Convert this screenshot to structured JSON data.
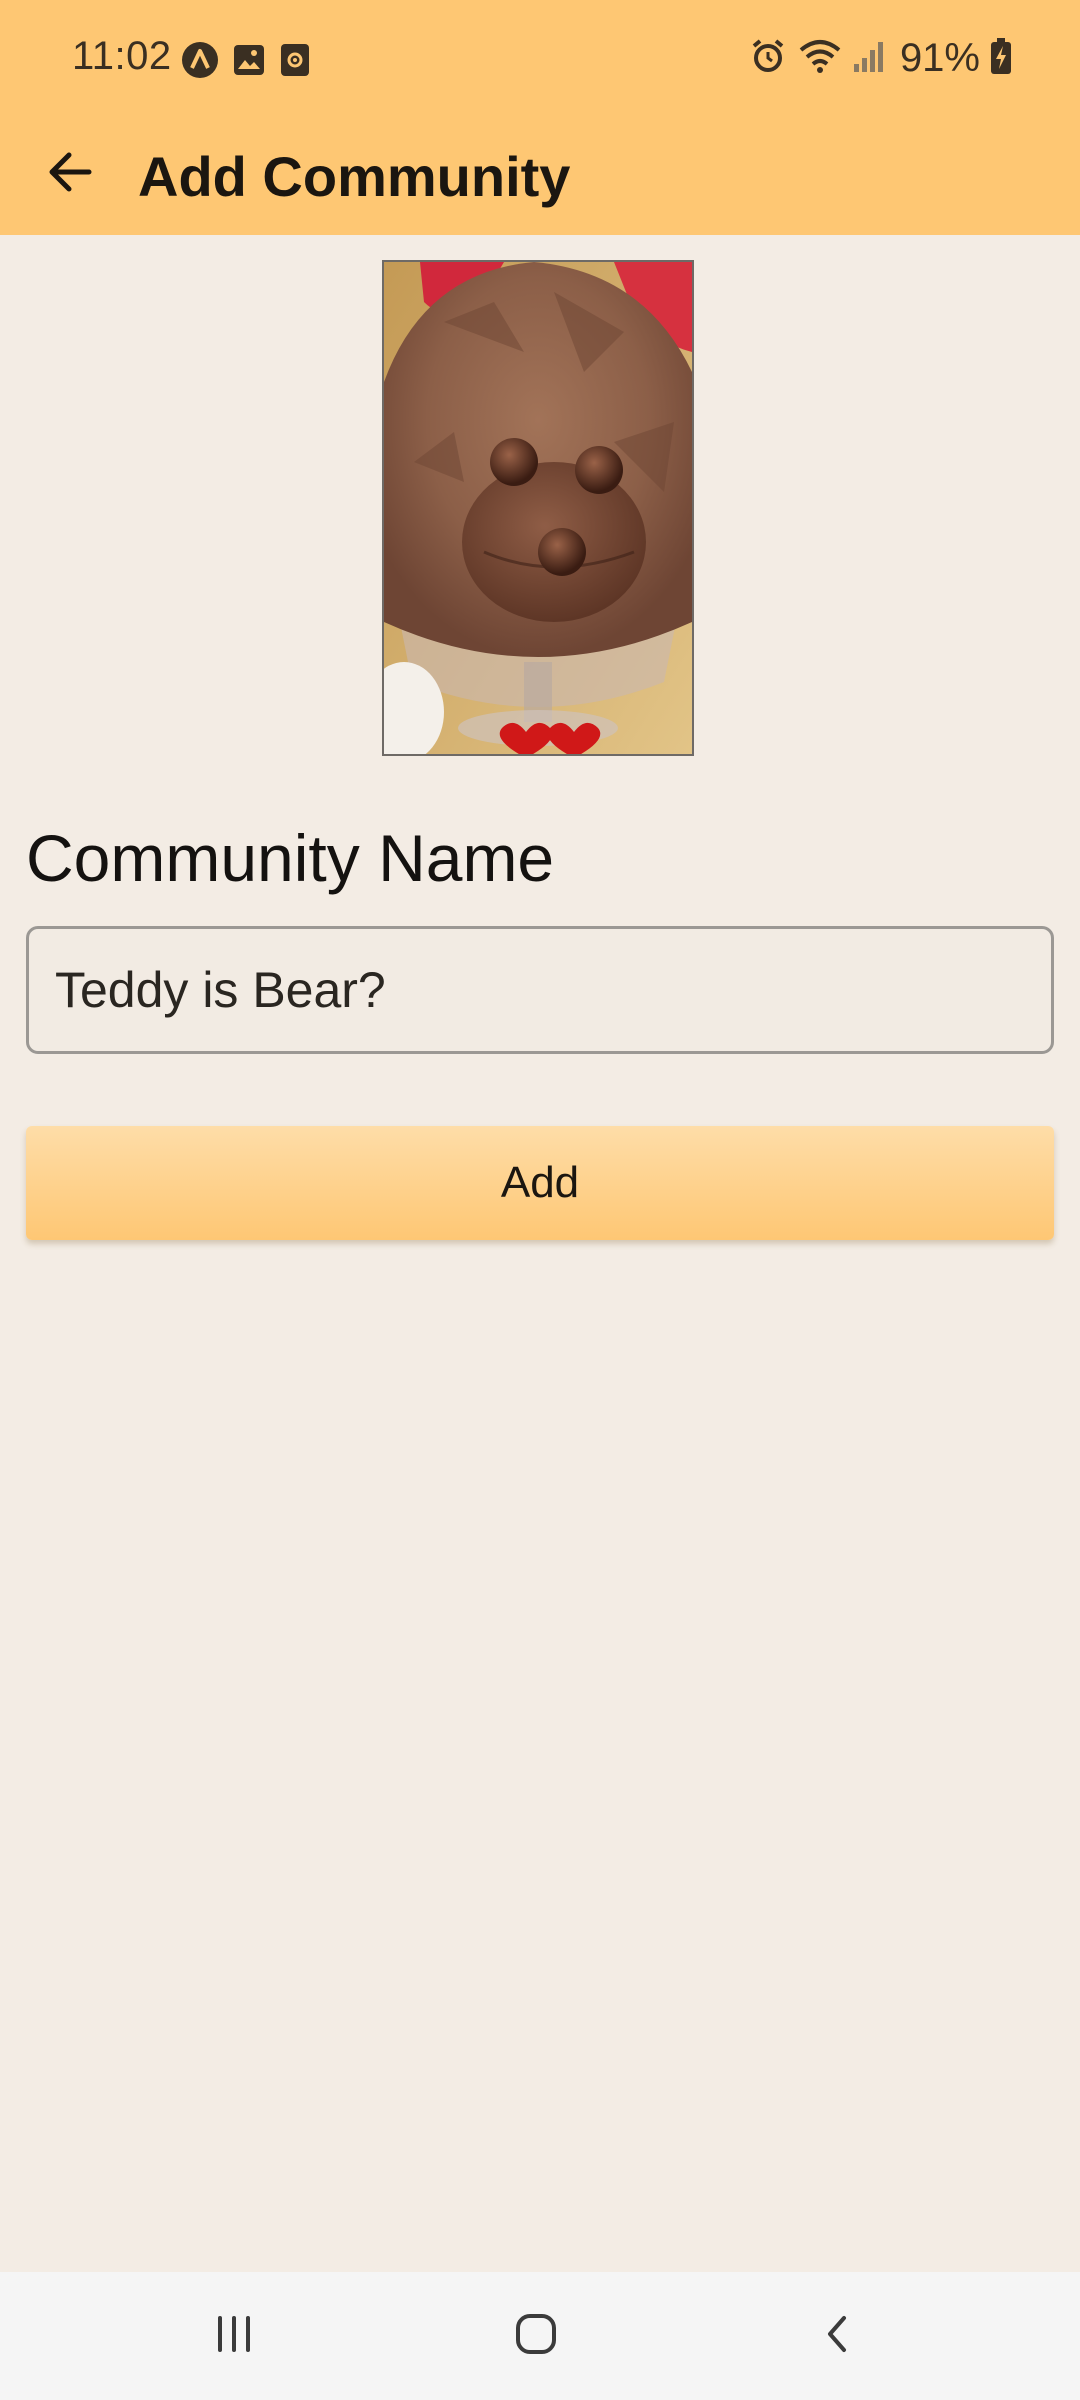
{
  "status_bar": {
    "time": "11:02",
    "battery_percent": "91%",
    "left_icons": [
      "a-circle-icon",
      "gallery-icon",
      "screen-record-icon"
    ],
    "right_icons": [
      "alarm-icon",
      "wifi-icon",
      "signal-icon",
      "battery-charging-icon"
    ]
  },
  "app_bar": {
    "title": "Add Community",
    "back_icon": "arrow-left-icon"
  },
  "form": {
    "name_label": "Community Name",
    "name_value": "Teddy is Bear?",
    "add_label": "Add"
  },
  "nav_bar": {
    "icons": [
      "recents-icon",
      "home-icon",
      "back-icon"
    ]
  },
  "colors": {
    "header": "#fec773",
    "background": "#f3ece4",
    "button_top": "#fedda8",
    "button_bottom": "#fec774"
  }
}
